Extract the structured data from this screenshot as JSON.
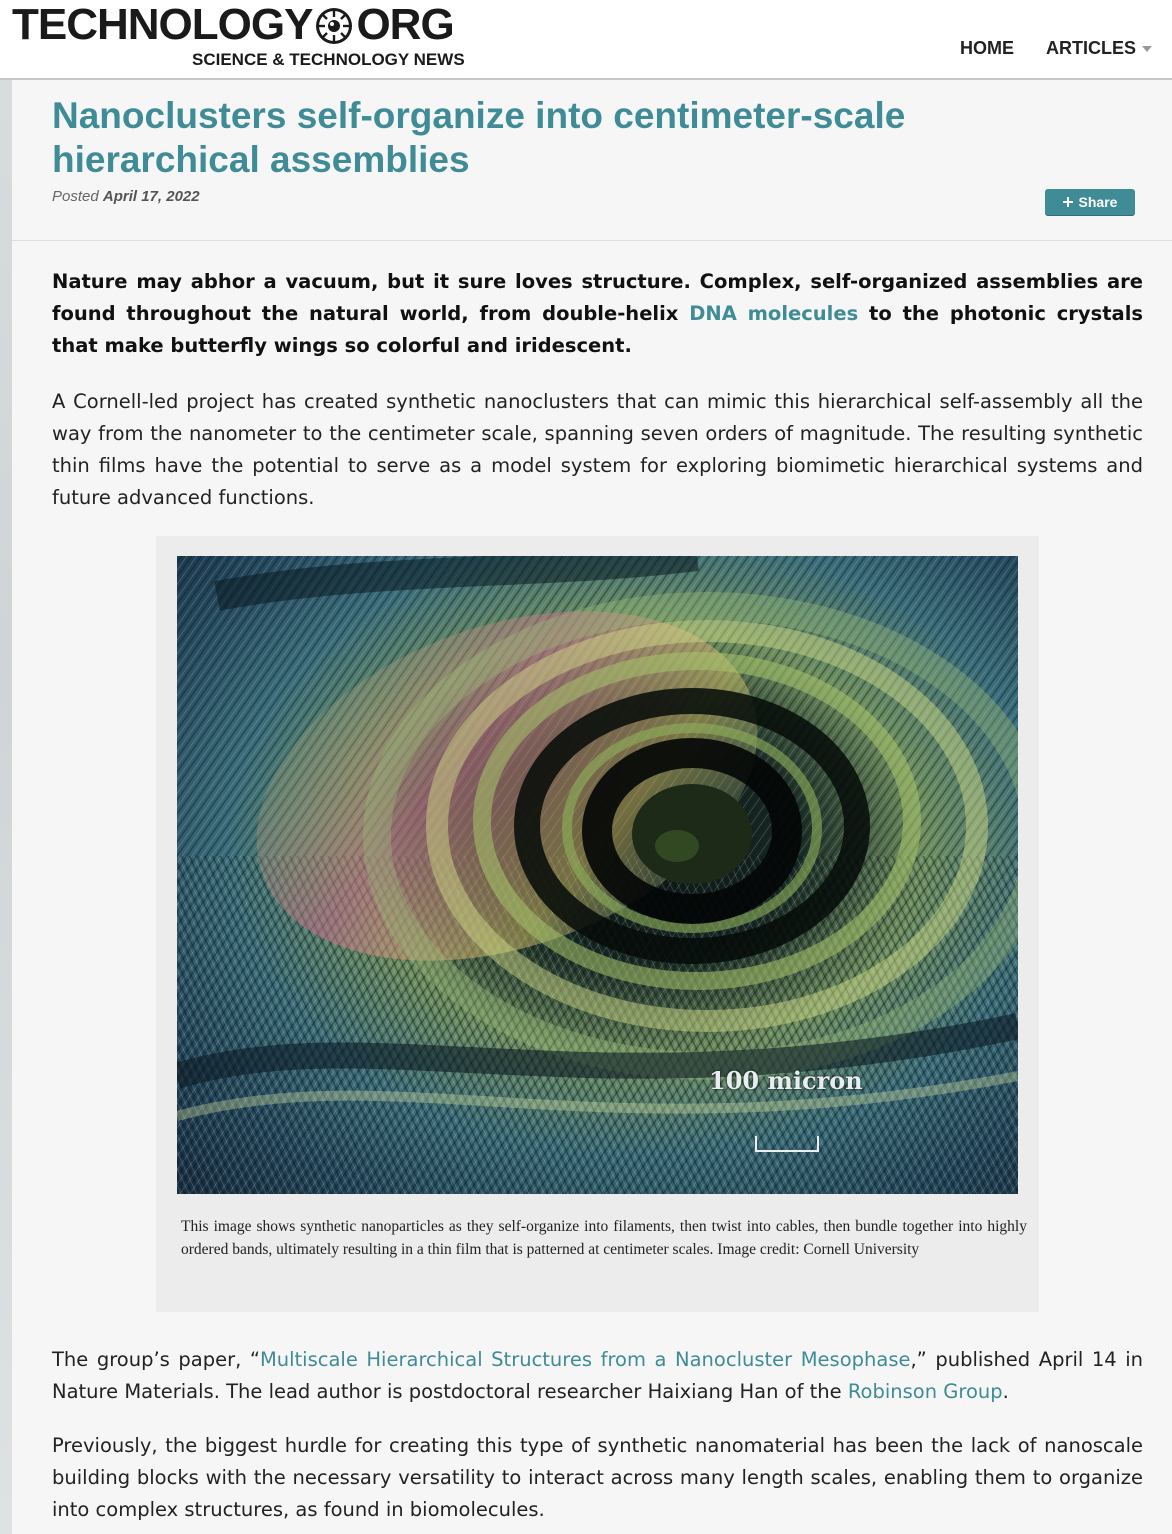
{
  "header": {
    "logo_left": "TECHNOLOGY",
    "logo_right": "ORG",
    "tagline": "SCIENCE & TECHNOLOGY NEWS",
    "nav": {
      "home": "HOME",
      "articles": "ARTICLES"
    }
  },
  "article": {
    "title": "Nanoclusters self-organize into centimeter-scale hierarchical assemblies",
    "posted_prefix": "Posted",
    "posted_date": "April 17, 2022",
    "share_label": "Share",
    "lead": {
      "before": "Nature may abhor a vacuum, but it sure loves structure. Complex, self-organized assemblies are found throughout the natural world, from double-helix ",
      "link": "DNA molecules",
      "after": " to the photonic crystals that make butterfly wings so colorful and iridescent."
    },
    "para1": "A Cornell-led project has created synthetic nanoclusters that can mimic this hierarchical self-assembly all the way from the nanometer to the centimeter scale, spanning seven orders of magnitude. The resulting synthetic thin films have the potential to serve as a model system for exploring biomimetic hierarchical systems and future advanced functions.",
    "figure": {
      "scale_label": "100 micron",
      "caption": "This image shows synthetic nanoparticles as they self-organize into filaments, then twist into cables, then bundle together into highly ordered bands, ultimately resulting in a thin film that is patterned at centimeter scales. Image credit: Cornell University"
    },
    "para2": {
      "before": "The group’s paper, “",
      "link1": "Multiscale Hierarchical Structures from a Nanocluster Mesophase",
      "middle": ",” published April 14 in Nature Materials. The lead author is postdoctoral researcher Haixiang Han of the ",
      "link2": "Robinson Group",
      "after": "."
    },
    "para3": "Previously, the biggest hurdle for creating this type of synthetic nanomaterial has been the lack of nanoscale building blocks with the necessary versatility to interact across many length scales, enabling them to organize into complex structures, as found in biomolecules."
  },
  "colors": {
    "accent": "#3f8c96",
    "background": "#f6f6f6",
    "figure_background": "#ececec"
  },
  "icons": [
    "logo-eye-icon",
    "caret-down-icon",
    "plus-icon"
  ]
}
